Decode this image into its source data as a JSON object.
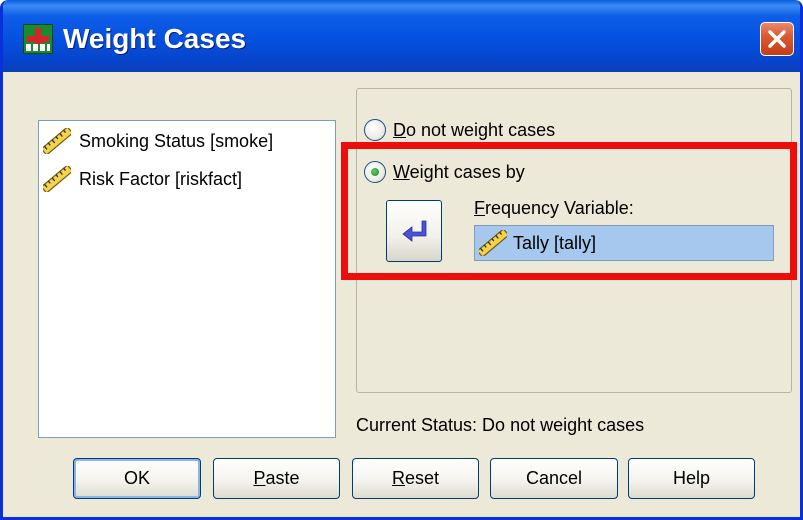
{
  "window": {
    "title": "Weight Cases"
  },
  "source_list": {
    "items": [
      {
        "label": "Smoking Status [smoke]",
        "icon": "scale-ruler-icon"
      },
      {
        "label": "Risk Factor [riskfact]",
        "icon": "scale-ruler-icon"
      }
    ]
  },
  "options": {
    "do_not_weight": {
      "accel": "D",
      "rest": "o not weight cases",
      "selected": false
    },
    "weight_by": {
      "accel": "W",
      "rest": "eight cases by",
      "selected": true
    }
  },
  "frequency": {
    "label_accel": "F",
    "label_rest": "requency Variable:",
    "value": "Tally [tally]"
  },
  "status": {
    "text": "Current Status: Do not weight cases"
  },
  "buttons": {
    "ok": {
      "text": "OK"
    },
    "paste": {
      "accel": "P",
      "rest": "aste"
    },
    "reset": {
      "accel": "R",
      "rest": "eset"
    },
    "cancel": {
      "text": "Cancel"
    },
    "help": {
      "text": "Help"
    }
  },
  "colors": {
    "titlebar": "#0550e0",
    "highlight": "#ee0d0d",
    "selected_field": "#a6c8ee"
  }
}
